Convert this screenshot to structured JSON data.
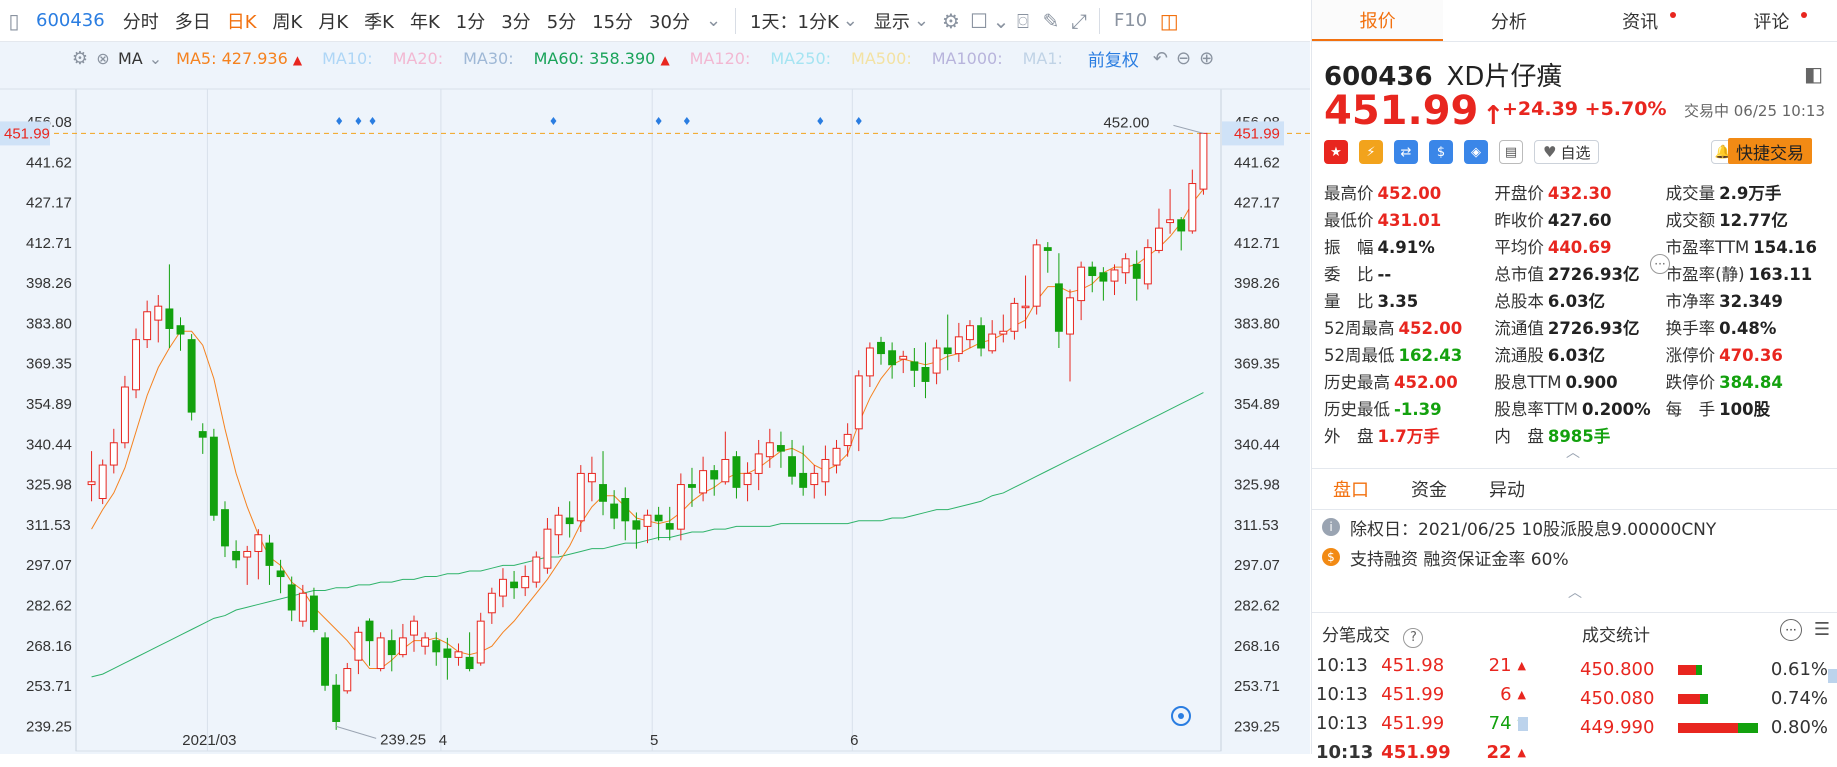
{
  "toolbar": {
    "code": "600436",
    "periods": [
      "分时",
      "多日",
      "日K",
      "周K",
      "月K",
      "季K",
      "年K",
      "1分",
      "3分",
      "5分",
      "15分",
      "30分"
    ],
    "active": "日K",
    "dropdown": "1天：1分K",
    "display": "显示",
    "f10": "F10"
  },
  "ma": {
    "label": "MA",
    "ma5_label": "MA5:",
    "ma5": "427.936",
    "ma10": "MA10:",
    "ma20": "MA20:",
    "ma30": "MA30:",
    "ma60_label": "MA60:",
    "ma60": "358.390",
    "ma120": "MA120:",
    "ma250": "MA250:",
    "ma500": "MA500:",
    "ma1000": "MA1000:",
    "ma1": "MA1:",
    "adjust": "前复权"
  },
  "chart_data": {
    "type": "candlestick",
    "y_ticks": [
      "456.08",
      "441.62",
      "427.17",
      "412.71",
      "398.26",
      "383.80",
      "369.35",
      "354.89",
      "340.44",
      "325.98",
      "311.53",
      "297.07",
      "282.62",
      "268.16",
      "253.71",
      "239.25"
    ],
    "ylim": [
      234,
      456.08
    ],
    "x_labels": [
      "2021/03",
      "4",
      "5",
      "6"
    ],
    "current_price": "451.99",
    "high_label": "452.00",
    "low_label": "239.25",
    "candles": [
      [
        326,
        327,
        320,
        338
      ],
      [
        321,
        333,
        319,
        335
      ],
      [
        333,
        341,
        330,
        346
      ],
      [
        341,
        361,
        339,
        365
      ],
      [
        360,
        378,
        357,
        382
      ],
      [
        378,
        388,
        375,
        392
      ],
      [
        385,
        390,
        377,
        394
      ],
      [
        389,
        382,
        375,
        405
      ],
      [
        383,
        380,
        374,
        386
      ],
      [
        378,
        352,
        349,
        380
      ],
      [
        345,
        343,
        337,
        348
      ],
      [
        343,
        315,
        313,
        346
      ],
      [
        317,
        304,
        300,
        320
      ],
      [
        302,
        299,
        296,
        306
      ],
      [
        300,
        302,
        290,
        304
      ],
      [
        302,
        308,
        292,
        310
      ],
      [
        305,
        297,
        290,
        308
      ],
      [
        295,
        293,
        287,
        299
      ],
      [
        290,
        281,
        277,
        293
      ],
      [
        277,
        287,
        275,
        290
      ],
      [
        286,
        274,
        273,
        289
      ],
      [
        271,
        254,
        252,
        273
      ],
      [
        254,
        241,
        238,
        258
      ],
      [
        252,
        260,
        251,
        262
      ],
      [
        263,
        273,
        258,
        275
      ],
      [
        277,
        270,
        261,
        278
      ],
      [
        260,
        271,
        259,
        273
      ],
      [
        270,
        265,
        259,
        274
      ],
      [
        265,
        271,
        264,
        276
      ],
      [
        272,
        277,
        266,
        279
      ],
      [
        268,
        271,
        265,
        273
      ],
      [
        270,
        266,
        261,
        273
      ],
      [
        267,
        264,
        256,
        271
      ],
      [
        264,
        266,
        261,
        269
      ],
      [
        264,
        260,
        259,
        273
      ],
      [
        262,
        277,
        261,
        280
      ],
      [
        280,
        287,
        276,
        289
      ],
      [
        286,
        292,
        282,
        296
      ],
      [
        291,
        289,
        285,
        295
      ],
      [
        289,
        293,
        286,
        297
      ],
      [
        291,
        300,
        289,
        302
      ],
      [
        296,
        310,
        294,
        314
      ],
      [
        308,
        315,
        301,
        318
      ],
      [
        314,
        312,
        307,
        320
      ],
      [
        313,
        330,
        309,
        333
      ],
      [
        327,
        330,
        320,
        336
      ],
      [
        326,
        320,
        315,
        338
      ],
      [
        319,
        314,
        310,
        324
      ],
      [
        321,
        313,
        306,
        325
      ],
      [
        313,
        310,
        303,
        316
      ],
      [
        311,
        315,
        305,
        317
      ],
      [
        315,
        313,
        306,
        318
      ],
      [
        312,
        310,
        306,
        318
      ],
      [
        310,
        326,
        306,
        330
      ],
      [
        326,
        325,
        318,
        332
      ],
      [
        323,
        331,
        320,
        336
      ],
      [
        331,
        328,
        322,
        333
      ],
      [
        327,
        335,
        326,
        345
      ],
      [
        336,
        325,
        321,
        338
      ],
      [
        326,
        330,
        320,
        334
      ],
      [
        330,
        337,
        324,
        342
      ],
      [
        336,
        341,
        332,
        346
      ],
      [
        340,
        338,
        332,
        345
      ],
      [
        336,
        329,
        326,
        342
      ],
      [
        330,
        325,
        322,
        340
      ],
      [
        326,
        330,
        321,
        333
      ],
      [
        327,
        335,
        322,
        340
      ],
      [
        333,
        339,
        330,
        342
      ],
      [
        340,
        344,
        336,
        348
      ],
      [
        346,
        365,
        338,
        367
      ],
      [
        365,
        375,
        361,
        377
      ],
      [
        377,
        373,
        369,
        379
      ],
      [
        374,
        369,
        364,
        377
      ],
      [
        371,
        372,
        366,
        374
      ],
      [
        370,
        367,
        361,
        375
      ],
      [
        368,
        363,
        357,
        377
      ],
      [
        366,
        375,
        362,
        378
      ],
      [
        375,
        373,
        367,
        387
      ],
      [
        373,
        379,
        370,
        384
      ],
      [
        378,
        383,
        375,
        385
      ],
      [
        383,
        375,
        372,
        386
      ],
      [
        374,
        380,
        373,
        385
      ],
      [
        380,
        381,
        377,
        387
      ],
      [
        381,
        391,
        378,
        393
      ],
      [
        390,
        390,
        382,
        401
      ],
      [
        390,
        412,
        387,
        414
      ],
      [
        411,
        410,
        402,
        413
      ],
      [
        398,
        381,
        375,
        409
      ],
      [
        380,
        393,
        363,
        396
      ],
      [
        392,
        404,
        385,
        406
      ],
      [
        404,
        401,
        395,
        406
      ],
      [
        402,
        399,
        392,
        404
      ],
      [
        399,
        403,
        394,
        405
      ],
      [
        402,
        407,
        398,
        409
      ],
      [
        405,
        400,
        392,
        410
      ],
      [
        398,
        411,
        396,
        414
      ],
      [
        410,
        418,
        409,
        425
      ],
      [
        420,
        421,
        416,
        432
      ],
      [
        421,
        417,
        410,
        422
      ],
      [
        417,
        434,
        416,
        439
      ],
      [
        432,
        452,
        430,
        452
      ]
    ],
    "ma5": [
      310,
      317,
      323,
      332,
      345,
      358,
      368,
      375,
      381,
      381,
      376,
      364,
      346,
      330,
      318,
      308,
      300,
      297,
      291,
      288,
      282,
      278,
      274,
      270,
      265,
      260,
      260,
      263,
      267,
      270,
      270,
      271,
      269,
      266,
      265,
      266,
      268,
      273,
      277,
      282,
      287,
      292,
      298,
      304,
      312,
      318,
      322,
      322,
      318,
      314,
      313,
      312,
      313,
      316,
      320,
      323,
      325,
      328,
      330,
      330,
      332,
      335,
      338,
      339,
      337,
      333,
      331,
      333,
      337,
      348,
      357,
      364,
      369,
      371,
      370,
      369,
      370,
      372,
      373,
      375,
      377,
      378,
      380,
      383,
      385,
      392,
      397,
      397,
      395,
      396,
      398,
      402,
      404,
      404,
      405,
      408,
      411,
      415,
      420,
      427,
      432
    ],
    "ma60": [
      257,
      258,
      260,
      262,
      264,
      266,
      268,
      270,
      272,
      274,
      276,
      278,
      279,
      281,
      282,
      283,
      284,
      285,
      286,
      287,
      288,
      288,
      289,
      289,
      290,
      290,
      291,
      291,
      292,
      292,
      293,
      293,
      294,
      294,
      295,
      295,
      296,
      297,
      297,
      298,
      299,
      300,
      300,
      301,
      302,
      303,
      303,
      304,
      305,
      305,
      306,
      307,
      307,
      308,
      309,
      309,
      310,
      310,
      311,
      311,
      311,
      311,
      312,
      312,
      312,
      312,
      312,
      312,
      312,
      313,
      313,
      313,
      314,
      314,
      315,
      316,
      317,
      317,
      318,
      319,
      320,
      322,
      323,
      325,
      327,
      329,
      331,
      333,
      335,
      337,
      339,
      341,
      343,
      345,
      347,
      349,
      351,
      353,
      355,
      357,
      359
    ]
  },
  "quote": {
    "code": "600436",
    "name": "XD片仔癀",
    "price": "451.99",
    "arrow": "↑",
    "change": "+24.39",
    "pct": "+5.70%",
    "status": "交易中 06/25 10:13",
    "watch": "自选",
    "trade": "快捷交易",
    "rows": [
      [
        [
          "最高价",
          "452.00",
          "red"
        ],
        [
          "开盘价",
          "432.30",
          "red"
        ],
        [
          "成交量",
          "2.9万手",
          "dark"
        ]
      ],
      [
        [
          "最低价",
          "431.01",
          "red"
        ],
        [
          "昨收价",
          "427.60",
          "dark"
        ],
        [
          "成交额",
          "12.77亿",
          "dark"
        ]
      ],
      [
        [
          "振　幅",
          "4.91%",
          "dark"
        ],
        [
          "平均价",
          "440.69",
          "red"
        ],
        [
          "市盈率TTM",
          "154.16",
          "dark"
        ]
      ],
      [
        [
          "委　比",
          "--",
          "dark"
        ],
        [
          "总市值",
          "2726.93亿",
          "dark"
        ],
        [
          "市盈率(静)",
          "163.11",
          "dark"
        ]
      ],
      [
        [
          "量　比",
          "3.35",
          "dark"
        ],
        [
          "总股本",
          "6.03亿",
          "dark"
        ],
        [
          "市净率",
          "32.349",
          "dark"
        ]
      ],
      [
        [
          "52周最高",
          "452.00",
          "red"
        ],
        [
          "流通值",
          "2726.93亿",
          "dark"
        ],
        [
          "换手率",
          "0.48%",
          "dark"
        ]
      ],
      [
        [
          "52周最低",
          "162.43",
          "green"
        ],
        [
          "流通股",
          "6.03亿",
          "dark"
        ],
        [
          "涨停价",
          "470.36",
          "red"
        ]
      ],
      [
        [
          "历史最高",
          "452.00",
          "red"
        ],
        [
          "股息TTM",
          "0.900",
          "dark"
        ],
        [
          "跌停价",
          "384.84",
          "green"
        ]
      ],
      [
        [
          "历史最低",
          "-1.39",
          "green"
        ],
        [
          "股息率TTM",
          "0.200%",
          "dark"
        ],
        [
          "每　手",
          "100股",
          "dark"
        ]
      ],
      [
        [
          "外　盘",
          "1.7万手",
          "red"
        ],
        [
          "内　盘",
          "8985手",
          "green"
        ],
        [
          "",
          "",
          " "
        ]
      ]
    ]
  },
  "tabs": {
    "items": [
      "报价",
      "分析",
      "资讯",
      "评论"
    ]
  },
  "subtabs": [
    "盘口",
    "资金",
    "异动"
  ],
  "info": {
    "line1": "除权日：2021/06/25  10股派股息9.00000CNY",
    "line2": "支持融资  融资保证金率 60%"
  },
  "ticks": {
    "title": "分笔成交",
    "rows": [
      [
        "10:13",
        "451.98",
        "21",
        "up"
      ],
      [
        "10:13",
        "451.99",
        "6",
        "up"
      ],
      [
        "10:13",
        "451.99",
        "74",
        "down"
      ],
      [
        "10:13",
        "451.99",
        "22",
        "up"
      ]
    ]
  },
  "stats": {
    "title": "成交统计",
    "rows": [
      [
        "450.800",
        "0.61%"
      ],
      [
        "450.080",
        "0.74%"
      ],
      [
        "449.990",
        "0.80%"
      ]
    ]
  }
}
